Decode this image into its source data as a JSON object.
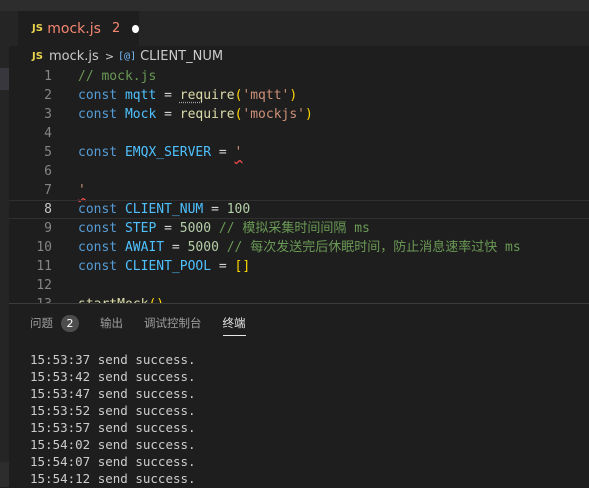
{
  "editor_tab": {
    "lang_badge": "JS",
    "filename": "mock.js",
    "problem_count": "2"
  },
  "breadcrumb": {
    "lang_badge": "JS",
    "file": "mock.js",
    "separator": ">",
    "symbol_icon": "[@]",
    "symbol": "CLIENT_NUM"
  },
  "code_lines": [
    {
      "n": "1",
      "tokens": [
        [
          "c-comment",
          "// mock.js"
        ]
      ]
    },
    {
      "n": "2",
      "tokens": [
        [
          "c-kw",
          "const"
        ],
        [
          "c-op",
          " "
        ],
        [
          "c-const",
          "mqtt"
        ],
        [
          "c-op",
          " = "
        ],
        [
          "c-fn dots",
          "req"
        ],
        [
          "c-fn",
          "uire"
        ],
        [
          "c-br",
          "("
        ],
        [
          "c-str",
          "'mqtt'"
        ],
        [
          "c-br",
          ")"
        ]
      ]
    },
    {
      "n": "3",
      "tokens": [
        [
          "c-kw",
          "const"
        ],
        [
          "c-op",
          " "
        ],
        [
          "c-const",
          "Mock"
        ],
        [
          "c-op",
          " = "
        ],
        [
          "c-fn",
          "require"
        ],
        [
          "c-br",
          "("
        ],
        [
          "c-str",
          "'mockjs'"
        ],
        [
          "c-br",
          ")"
        ]
      ]
    },
    {
      "n": "4",
      "tokens": []
    },
    {
      "n": "5",
      "tokens": [
        [
          "c-kw",
          "const"
        ],
        [
          "c-op",
          " "
        ],
        [
          "c-const",
          "EMQX_SERVER"
        ],
        [
          "c-op",
          " = "
        ],
        [
          "c-str squig",
          "'"
        ]
      ]
    },
    {
      "n": "6",
      "tokens": []
    },
    {
      "n": "7",
      "tokens": [
        [
          "c-str squig",
          "'"
        ]
      ]
    },
    {
      "n": "8",
      "tokens": [
        [
          "c-kw",
          "const"
        ],
        [
          "c-op",
          " "
        ],
        [
          "c-const",
          "CLIENT_NUM"
        ],
        [
          "c-op",
          " = "
        ],
        [
          "c-num",
          "100"
        ]
      ]
    },
    {
      "n": "9",
      "tokens": [
        [
          "c-kw",
          "const"
        ],
        [
          "c-op",
          " "
        ],
        [
          "c-const",
          "STEP"
        ],
        [
          "c-op",
          " = "
        ],
        [
          "c-num",
          "5000"
        ],
        [
          "c-op",
          " "
        ],
        [
          "c-comment",
          "// 模拟采集时间间隔 ms"
        ]
      ]
    },
    {
      "n": "10",
      "tokens": [
        [
          "c-kw",
          "const"
        ],
        [
          "c-op",
          " "
        ],
        [
          "c-const",
          "AWAIT"
        ],
        [
          "c-op",
          " = "
        ],
        [
          "c-num",
          "5000"
        ],
        [
          "c-op",
          " "
        ],
        [
          "c-comment",
          "// 每次发送完后休眠时间，防止消息速率过快 ms"
        ]
      ]
    },
    {
      "n": "11",
      "tokens": [
        [
          "c-kw",
          "const"
        ],
        [
          "c-op",
          " "
        ],
        [
          "c-const",
          "CLIENT_POOL"
        ],
        [
          "c-op",
          " = "
        ],
        [
          "c-br",
          "[]"
        ]
      ]
    },
    {
      "n": "12",
      "tokens": []
    },
    {
      "n": "13",
      "tokens": [
        [
          "c-fn",
          "startMock"
        ],
        [
          "c-br",
          "()"
        ]
      ]
    }
  ],
  "panel": {
    "tabs": [
      {
        "label": "问题",
        "badge": "2"
      },
      {
        "label": "输出"
      },
      {
        "label": "调试控制台"
      },
      {
        "label": "终端"
      }
    ],
    "active_tab": "终端"
  },
  "terminal_lines": [
    "15:53:37 send success.",
    "15:53:42 send success.",
    "15:53:47 send success.",
    "15:53:52 send success.",
    "15:53:57 send success.",
    "15:54:02 send success.",
    "15:54:07 send success.",
    "15:54:12 send success."
  ]
}
